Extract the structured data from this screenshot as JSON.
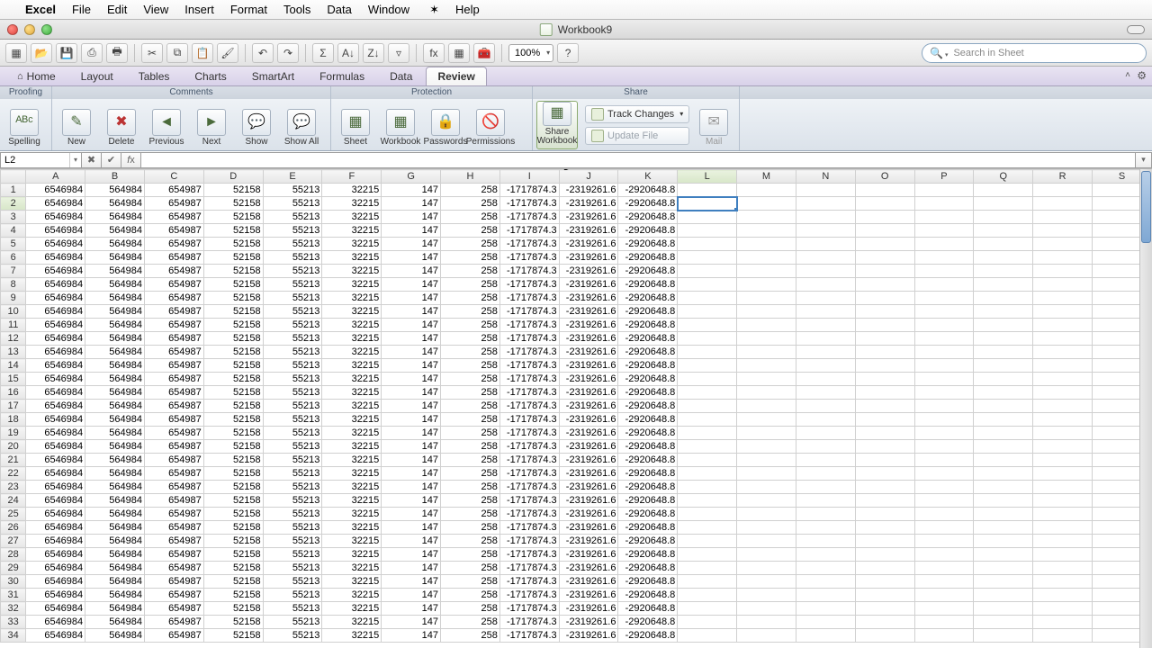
{
  "menubar": {
    "app": "Excel",
    "items": [
      "File",
      "Edit",
      "View",
      "Insert",
      "Format",
      "Tools",
      "Data",
      "Window",
      "Help"
    ]
  },
  "window": {
    "title": "Workbook9"
  },
  "qat": {
    "zoom": "100%",
    "search_placeholder": "Search in Sheet"
  },
  "ribbon": {
    "tabs": [
      "Home",
      "Layout",
      "Tables",
      "Charts",
      "SmartArt",
      "Formulas",
      "Data",
      "Review"
    ],
    "active_tab": "Review",
    "groups": {
      "proofing": {
        "label": "Proofing",
        "spelling": "Spelling"
      },
      "comments": {
        "label": "Comments",
        "new": "New",
        "delete": "Delete",
        "previous": "Previous",
        "next": "Next",
        "show": "Show",
        "show_all": "Show All"
      },
      "protection": {
        "label": "Protection",
        "sheet": "Sheet",
        "workbook": "Workbook",
        "passwords": "Passwords",
        "permissions": "Permissions"
      },
      "share": {
        "label": "Share",
        "share_workbook": "Share Workbook",
        "track_changes": "Track Changes",
        "update_file": "Update File",
        "mail": "Mail"
      }
    }
  },
  "formula_bar": {
    "cell_ref": "L2",
    "formula": ""
  },
  "grid": {
    "columns": [
      "A",
      "B",
      "C",
      "D",
      "E",
      "F",
      "G",
      "H",
      "I",
      "J",
      "K",
      "L",
      "M",
      "N",
      "O",
      "P",
      "Q",
      "R",
      "S"
    ],
    "active_col": "L",
    "active_row": 2,
    "row_count": 34,
    "row_values": {
      "A": "6546984",
      "B": "564984",
      "C": "654987",
      "D": "52158",
      "E": "55213",
      "F": "32215",
      "G": "147",
      "H": "258",
      "I": "-1717874.3",
      "J": "-2319261.6",
      "K": "-2920648.8"
    }
  },
  "chart_data": {
    "type": "table",
    "title": "Workbook9 sheet data (rows 1–34, columns A–K repeated)",
    "columns": [
      "A",
      "B",
      "C",
      "D",
      "E",
      "F",
      "G",
      "H",
      "I",
      "J",
      "K"
    ],
    "row_template": [
      6546984,
      564984,
      654987,
      52158,
      55213,
      32215,
      147,
      258,
      -1717874.3,
      -2319261.6,
      -2920648.8
    ],
    "rows": 34
  }
}
